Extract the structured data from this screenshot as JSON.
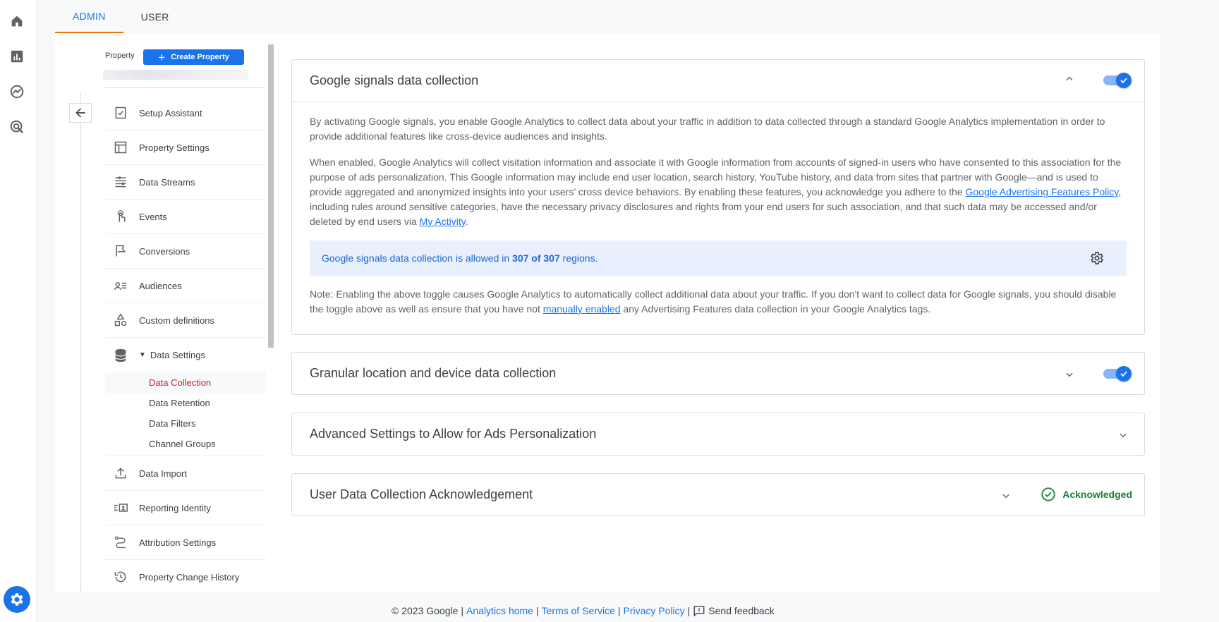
{
  "tabs": {
    "admin": "ADMIN",
    "user": "USER"
  },
  "property": {
    "label": "Property",
    "create_button": "Create Property"
  },
  "nav": {
    "items": [
      {
        "label": "Setup Assistant",
        "icon": "checklist-icon"
      },
      {
        "label": "Property Settings",
        "icon": "property-settings-icon"
      },
      {
        "label": "Data Streams",
        "icon": "data-streams-icon"
      },
      {
        "label": "Events",
        "icon": "events-icon"
      },
      {
        "label": "Conversions",
        "icon": "flag-icon"
      },
      {
        "label": "Audiences",
        "icon": "audiences-icon"
      },
      {
        "label": "Custom definitions",
        "icon": "shapes-icon"
      },
      {
        "label": "Data Settings",
        "icon": "database-icon"
      }
    ],
    "sub_items": [
      "Data Collection",
      "Data Retention",
      "Data Filters",
      "Channel Groups"
    ],
    "bottom_items": [
      {
        "label": "Data Import",
        "icon": "upload-icon"
      },
      {
        "label": "Reporting Identity",
        "icon": "reporting-identity-icon"
      },
      {
        "label": "Attribution Settings",
        "icon": "attribution-icon"
      },
      {
        "label": "Property Change History",
        "icon": "history-icon"
      }
    ]
  },
  "panels": {
    "signals": {
      "title": "Google signals data collection",
      "p1": "By activating Google signals, you enable Google Analytics to collect data about your traffic in addition to data collected through a standard Google Analytics implementation in order to provide additional features like cross-device audiences and insights.",
      "p2a": "When enabled, Google Analytics will collect visitation information and associate it with Google information from accounts of signed-in users who have consented to this association for the purpose of ads personalization. This Google information may include end user location, search history, YouTube history, and data from sites that partner with Google—and is used to provide aggregated and anonymized insights into your users’ cross device behaviors. By enabling these features, you acknowledge you adhere to the ",
      "p2_link1": "Google Advertising Features Policy",
      "p2b": ", including rules around sensitive categories, have the necessary privacy disclosures and rights from your end users for such association, and that such data may be accessed and/or deleted by end users via ",
      "p2_link2": "My Activity",
      "p2c": ".",
      "info_prefix": "Google signals data collection is allowed in ",
      "info_count": "307 of 307",
      "info_suffix": " regions.",
      "note_a": "Note: Enabling the above toggle causes Google Analytics to automatically collect additional data about your traffic. If you don't want to collect data for Google signals, you should disable the toggle above as well as ensure that you have not ",
      "note_link": "manually enabled",
      "note_b": " any Advertising Features data collection in your Google Analytics tags.",
      "toggle_on": true
    },
    "granular": {
      "title": "Granular location and device data collection",
      "toggle_on": true
    },
    "advanced": {
      "title": "Advanced Settings to Allow for Ads Personalization"
    },
    "user_data": {
      "title": "User Data Collection Acknowledgement",
      "status": "Acknowledged"
    }
  },
  "footer": {
    "copyright": "© 2023 Google",
    "analytics_home": "Analytics home",
    "terms": "Terms of Service",
    "privacy": "Privacy Policy",
    "feedback": "Send feedback"
  },
  "colors": {
    "accent": "#1a73e8",
    "active_nav": "#c5221f",
    "success": "#188038",
    "tab_indicator": "#e8710a"
  }
}
